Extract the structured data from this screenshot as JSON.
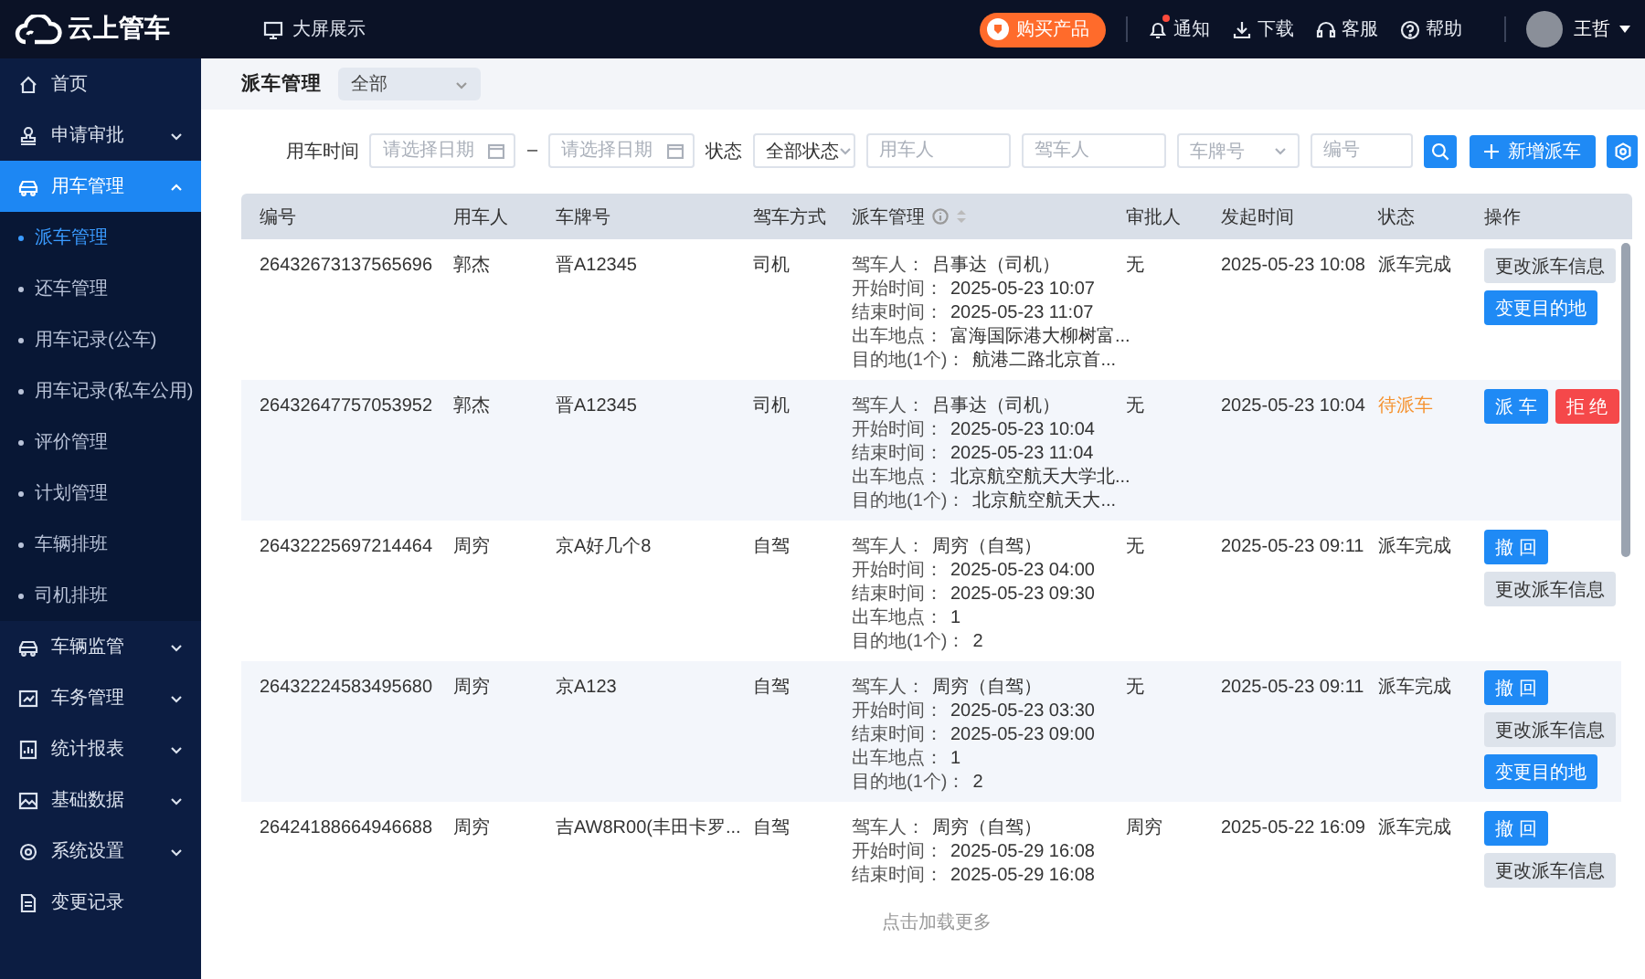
{
  "topbar": {
    "brand": "云上管车",
    "screen_link": "大屏展示",
    "buy_button": "购买产品",
    "actions": [
      {
        "label": "通知",
        "kind": "bell",
        "badge": true
      },
      {
        "label": "下载",
        "kind": "download",
        "badge": false
      },
      {
        "label": "客服",
        "kind": "headset",
        "badge": false
      },
      {
        "label": "帮助",
        "kind": "help",
        "badge": false
      }
    ],
    "user": {
      "name": "王哲"
    }
  },
  "sidebar": {
    "items": [
      {
        "label": "首页",
        "selected": false
      },
      {
        "label": "申请审批",
        "selected": false,
        "expanded": false
      },
      {
        "label": "用车管理",
        "selected": true,
        "expanded": true,
        "children": [
          {
            "label": "派车管理",
            "selected": true
          },
          {
            "label": "还车管理",
            "selected": false
          },
          {
            "label": "用车记录(公车)",
            "selected": false
          },
          {
            "label": "用车记录(私车公用)",
            "selected": false
          },
          {
            "label": "评价管理",
            "selected": false
          },
          {
            "label": "计划管理",
            "selected": false
          },
          {
            "label": "车辆排班",
            "selected": false
          },
          {
            "label": "司机排班",
            "selected": false
          }
        ]
      },
      {
        "label": "车辆监管",
        "selected": false,
        "expanded": false
      },
      {
        "label": "车务管理",
        "selected": false,
        "expanded": false
      },
      {
        "label": "统计报表",
        "selected": false,
        "expanded": false
      },
      {
        "label": "基础数据",
        "selected": false,
        "expanded": false
      },
      {
        "label": "系统设置",
        "selected": false,
        "expanded": false
      },
      {
        "label": "变更记录",
        "selected": false
      }
    ]
  },
  "page_header": {
    "title": "派车管理",
    "scope_select": "全部"
  },
  "filters": {
    "time_label": "用车时间",
    "start_date": {
      "placeholder": "请选择日期"
    },
    "separator": "–",
    "end_date": {
      "placeholder": "请选择日期"
    },
    "status_label": "状态",
    "status_select": "全部状态",
    "user_field": {
      "placeholder": "用车人"
    },
    "driver_field": {
      "placeholder": "驾车人"
    },
    "plate_select": {
      "placeholder": "车牌号"
    },
    "number_field": {
      "placeholder": "编号"
    },
    "add_button": "新增派车"
  },
  "table": {
    "columns": [
      {
        "label": "编号",
        "kind": "plain"
      },
      {
        "label": "用车人",
        "kind": "plain"
      },
      {
        "label": "车牌号",
        "kind": "plain"
      },
      {
        "label": "驾车方式",
        "kind": "plain"
      },
      {
        "label": "派车管理",
        "kind": "sortable"
      },
      {
        "label": "审批人",
        "kind": "plain"
      },
      {
        "label": "发起时间",
        "kind": "plain"
      },
      {
        "label": "状态",
        "kind": "plain"
      },
      {
        "label": "操作",
        "kind": "plain"
      }
    ],
    "rows": [
      {
        "number": "26432673137565696",
        "user": "郭杰",
        "plate": "晋A12345",
        "drive_mode": "司机",
        "details": [
          {
            "label": "驾车人：",
            "value": "吕事达（司机）"
          },
          {
            "label": "开始时间：",
            "value": "2025-05-23 10:07"
          },
          {
            "label": "结束时间：",
            "value": "2025-05-23 11:07"
          },
          {
            "label": "出车地点：",
            "value": "富海国际港大柳树富..."
          },
          {
            "label": "目的地(1个)：",
            "value": "航港二路北京首..."
          }
        ],
        "approver": "无",
        "created": "2025-05-23 10:08",
        "status": {
          "text": "派车完成",
          "kind": "done"
        },
        "actions": [
          {
            "label": "更改派车信息",
            "kind": "default"
          },
          {
            "label": "变更目的地",
            "kind": "primary"
          }
        ]
      },
      {
        "number": "26432647757053952",
        "user": "郭杰",
        "plate": "晋A12345",
        "drive_mode": "司机",
        "details": [
          {
            "label": "驾车人：",
            "value": "吕事达（司机）"
          },
          {
            "label": "开始时间：",
            "value": "2025-05-23 10:04"
          },
          {
            "label": "结束时间：",
            "value": "2025-05-23 11:04"
          },
          {
            "label": "出车地点：",
            "value": "北京航空航天大学北..."
          },
          {
            "label": "目的地(1个)：",
            "value": "北京航空航天大..."
          }
        ],
        "approver": "无",
        "created": "2025-05-23 10:04",
        "status": {
          "text": "待派车",
          "kind": "pending"
        },
        "actions": [
          {
            "label": "派 车",
            "kind": "primary"
          },
          {
            "label": "拒 绝",
            "kind": "danger"
          }
        ]
      },
      {
        "number": "26432225697214464",
        "user": "周穷",
        "plate": "京A好几个8",
        "drive_mode": "自驾",
        "details": [
          {
            "label": "驾车人：",
            "value": "周穷（自驾）"
          },
          {
            "label": "开始时间：",
            "value": "2025-05-23 04:00"
          },
          {
            "label": "结束时间：",
            "value": "2025-05-23 09:30"
          },
          {
            "label": "出车地点：",
            "value": "1"
          },
          {
            "label": "目的地(1个)：",
            "value": "2"
          }
        ],
        "approver": "无",
        "created": "2025-05-23 09:11",
        "status": {
          "text": "派车完成",
          "kind": "done"
        },
        "actions": [
          {
            "label": "撤 回",
            "kind": "primary"
          },
          {
            "label": "更改派车信息",
            "kind": "default"
          }
        ]
      },
      {
        "number": "26432224583495680",
        "user": "周穷",
        "plate": "京A123",
        "drive_mode": "自驾",
        "details": [
          {
            "label": "驾车人：",
            "value": "周穷（自驾）"
          },
          {
            "label": "开始时间：",
            "value": "2025-05-23 03:30"
          },
          {
            "label": "结束时间：",
            "value": "2025-05-23 09:00"
          },
          {
            "label": "出车地点：",
            "value": "1"
          },
          {
            "label": "目的地(1个)：",
            "value": "2"
          }
        ],
        "approver": "无",
        "created": "2025-05-23 09:11",
        "status": {
          "text": "派车完成",
          "kind": "done"
        },
        "actions": [
          {
            "label": "撤 回",
            "kind": "primary"
          },
          {
            "label": "更改派车信息",
            "kind": "default"
          },
          {
            "label": "变更目的地",
            "kind": "primary"
          }
        ]
      },
      {
        "number": "26424188664946688",
        "user": "周穷",
        "plate": "吉AW8R00(丰田卡罗...",
        "drive_mode": "自驾",
        "details": [
          {
            "label": "驾车人：",
            "value": "周穷（自驾）"
          },
          {
            "label": "开始时间：",
            "value": "2025-05-29 16:08"
          },
          {
            "label": "结束时间：",
            "value": "2025-05-29 16:08"
          }
        ],
        "approver": "周穷",
        "created": "2025-05-22 16:09",
        "status": {
          "text": "派车完成",
          "kind": "done"
        },
        "actions": [
          {
            "label": "撤 回",
            "kind": "primary"
          },
          {
            "label": "更改派车信息",
            "kind": "default"
          }
        ]
      }
    ],
    "load_more": "点击加载更多"
  }
}
